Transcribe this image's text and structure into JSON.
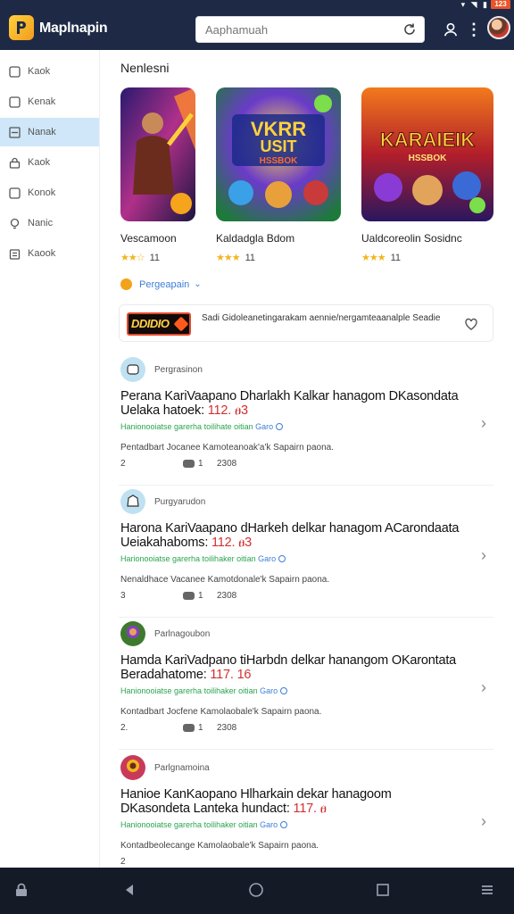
{
  "status": {
    "battery": "123",
    "signal": "▾ ◥ ▮"
  },
  "app": {
    "title": "Maplnapin",
    "search_placeholder": "Aaphamuah"
  },
  "sidebar": {
    "items": [
      {
        "label": "Kaok",
        "icon": "checkbox-icon"
      },
      {
        "label": "Kenak",
        "icon": "checkbox-icon"
      },
      {
        "label": "Nanak",
        "icon": "list-icon",
        "active": true
      },
      {
        "label": "Kaok",
        "icon": "lock-icon"
      },
      {
        "label": "Konok",
        "icon": "checkbox-icon"
      },
      {
        "label": "Nanic",
        "icon": "bulb-icon"
      },
      {
        "label": "Kaook",
        "icon": "clipboard-icon"
      }
    ]
  },
  "section_title": "Nenlesni",
  "games": [
    {
      "name": "Vescamoon",
      "rating": "11",
      "stars": "★★☆"
    },
    {
      "name": "Kaldadgla Bdom",
      "rating": "11",
      "stars": "★★★"
    },
    {
      "name": "Ualdcoreolin Sosidnc",
      "rating": "11",
      "stars": "★★★"
    }
  ],
  "game_art_text": {
    "g2_line1": "VKRR",
    "g2_line2": "USIT",
    "g2_line3": "HSSBOK",
    "g3_line1": "KARAIEIK",
    "g3_line2": "HSSBOK"
  },
  "filter": {
    "label": "Pergeapain"
  },
  "banner": {
    "logo": "DDIDIO",
    "text": "Sadi Gidoleanetingarakam aennie/nergamteaanalple Seadie"
  },
  "posts": [
    {
      "user": "Pergrasinon",
      "title": "Perana KariVaapano Dharlakh Kalkar hanagom DKasondata Uelaka hatoek: ",
      "title_num": "112. ፀ3",
      "tags": "Hanionooiatse garerha toilihate oitian ",
      "tags_blue": "Garo",
      "desc": "Pentadbart Jocanee Kamoteanoak'a'k Sapairn paona.",
      "count": "2",
      "comments": "1",
      "time": "2308"
    },
    {
      "user": "Purgyarudon",
      "title": "Harona KariVaapano dHarkeh delkar hanagom ACarondaata Ueiakahaboms: ",
      "title_num": "112. ፀ3",
      "tags": "Harionooiatse garerha toilihaker oitian ",
      "tags_blue": "Garo",
      "desc": "Nenaldhace Vacanee Kamotdonale'k Sapairn paona.",
      "count": "3",
      "comments": "1",
      "time": "2308"
    },
    {
      "user": "Parlnagoubon",
      "title": "Hamda KariVadpano tiHarbdn delkar hanangom OKarontata Beradahatome: ",
      "title_num": "117. 16",
      "tags": "Hanionooiatse garerha toilihaker oitian ",
      "tags_blue": "Garo",
      "desc": "Kontadbart Jocfene Kamolaobale'k Sapairn paona.",
      "count": "2.",
      "comments": "1",
      "time": "2308"
    },
    {
      "user": "Parlgnamoina",
      "title": "Hanioe KanKaopano Hlharkain dekar hanagoom DKasondeta Lanteka hundact: ",
      "title_num": "117. ፀ",
      "tags": "Hanionooiatse garerha toilihaker oitian ",
      "tags_blue": "Garo",
      "desc": "Kontadbeolecange Kamolaobale'k Sapairn paona.",
      "count": "2",
      "comments": "",
      "time": ""
    }
  ],
  "colors": {
    "appbar": "#1e2a45",
    "accent": "#3d7fd6",
    "sidebar_active": "#cfe7f8",
    "tag_green": "#2aa44f",
    "number_red": "#d23030"
  }
}
